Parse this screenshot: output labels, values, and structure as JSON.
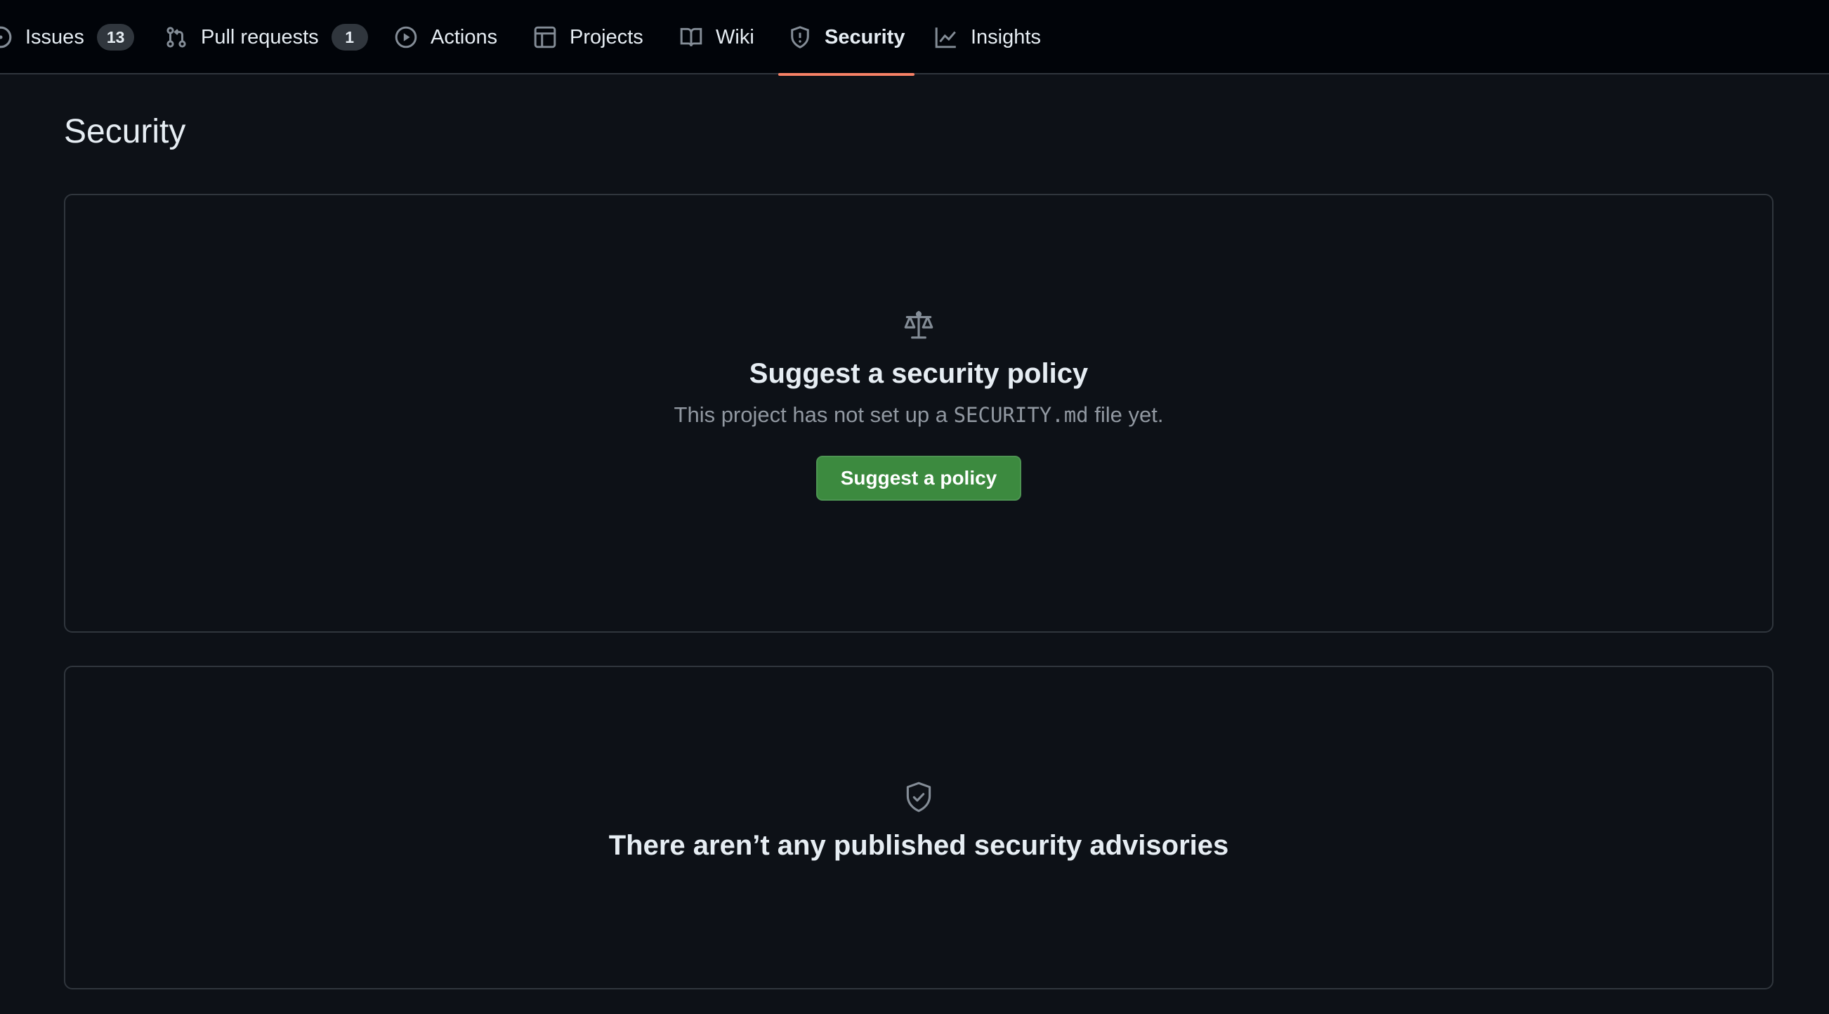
{
  "nav": {
    "tabs": [
      {
        "label": "Issues",
        "count": "13",
        "icon": "issue-opened-icon"
      },
      {
        "label": "Pull requests",
        "count": "1",
        "icon": "git-pull-request-icon"
      },
      {
        "label": "Actions",
        "icon": "play-icon"
      },
      {
        "label": "Projects",
        "icon": "table-icon"
      },
      {
        "label": "Wiki",
        "icon": "book-icon"
      },
      {
        "label": "Security",
        "icon": "shield-icon",
        "active": true
      },
      {
        "label": "Insights",
        "icon": "graph-icon"
      }
    ]
  },
  "page": {
    "title": "Security"
  },
  "policy": {
    "icon": "law-icon",
    "title": "Suggest a security policy",
    "desc_before": "This project has not set up a ",
    "desc_code": "SECURITY.md",
    "desc_after": " file yet.",
    "button_label": "Suggest a policy"
  },
  "advisories": {
    "icon": "shield-check-icon",
    "title": "There aren’t any published security advisories"
  },
  "colors": {
    "background": "#0d1117",
    "header": "#010409",
    "border": "#30363d",
    "active_underline": "#f78166",
    "primary_button": "#3c8a3f"
  }
}
